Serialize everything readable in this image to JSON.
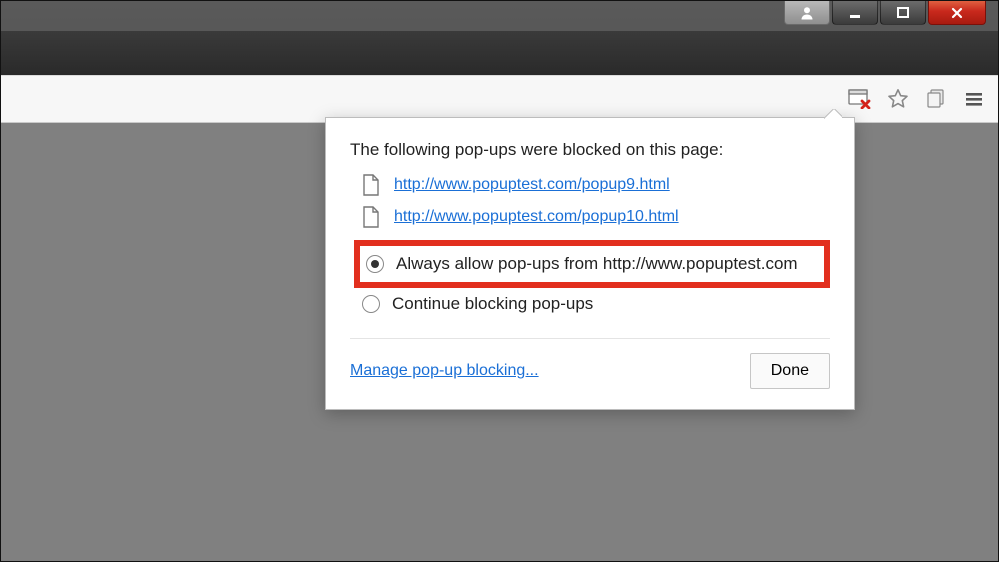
{
  "popup": {
    "heading": "The following pop-ups were blocked on this page:",
    "blocked": [
      "http://www.popuptest.com/popup9.html",
      "http://www.popuptest.com/popup10.html"
    ],
    "options": {
      "allow": "Always allow pop-ups from http://www.popuptest.com",
      "block": "Continue blocking pop-ups",
      "selected": "allow"
    },
    "manage_label": "Manage pop-up blocking...",
    "done_label": "Done"
  },
  "colors": {
    "highlight": "#e22f1e",
    "link": "#1a6fd6"
  }
}
